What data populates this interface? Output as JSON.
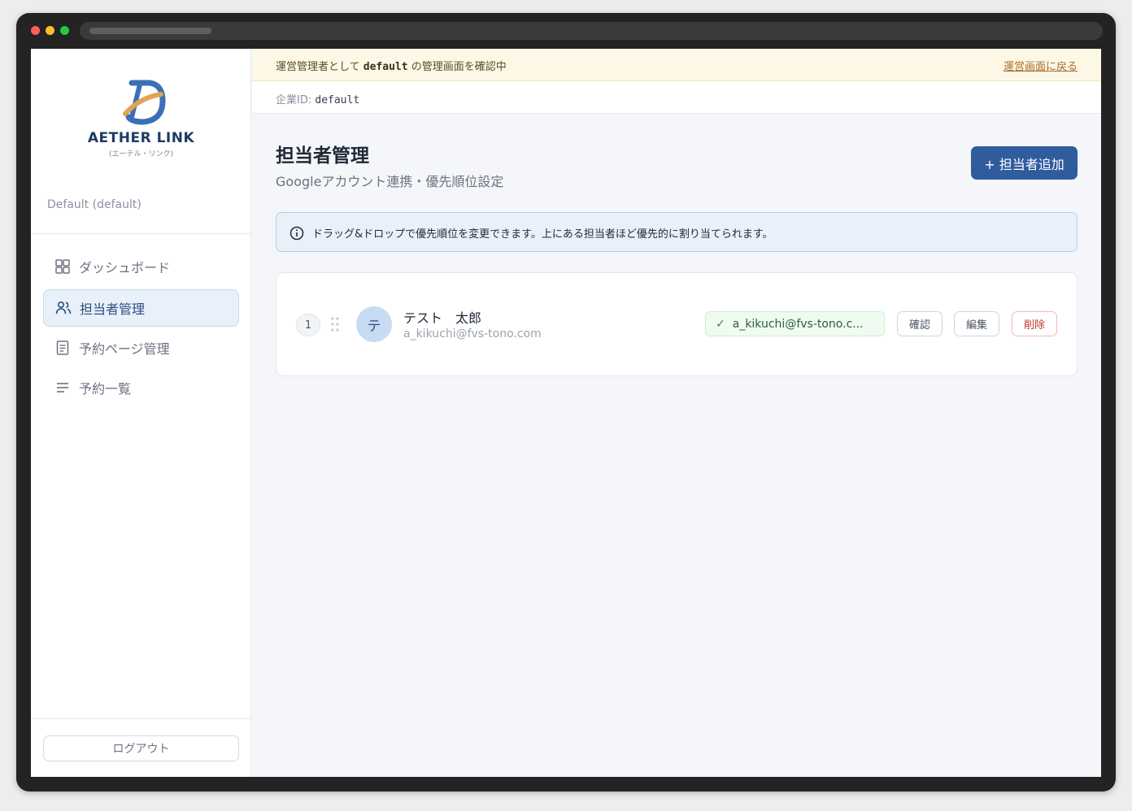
{
  "sidebar": {
    "brand": "AETHER LINK",
    "brand_sub": "(エーテル・リンク)",
    "tenant": "Default (default)",
    "items": [
      {
        "label": "ダッシュボード",
        "icon": "grid-icon"
      },
      {
        "label": "担当者管理",
        "icon": "users-icon",
        "active": true
      },
      {
        "label": "予約ページ管理",
        "icon": "document-icon"
      },
      {
        "label": "予約一覧",
        "icon": "list-icon"
      }
    ],
    "logout_label": "ログアウト"
  },
  "banner": {
    "prefix": "運営管理者として",
    "tenant_code": "default",
    "suffix": "の管理画面を確認中",
    "back_link": "運営画面に戻る"
  },
  "company": {
    "label": "企業ID:",
    "value": "default"
  },
  "page": {
    "title": "担当者管理",
    "subtitle": "Googleアカウント連携・優先順位設定",
    "add_button": "+ 担当者追加"
  },
  "info": {
    "text": "ドラッグ&ドロップで優先順位を変更できます。上にある担当者ほど優先的に割り当てられます。"
  },
  "staff": [
    {
      "rank": "1",
      "avatar": "テ",
      "name": "テスト　太郎",
      "email": "a_kikuchi@fvs-tono.com",
      "google_account": "a_kikuchi@fvs-tono.c...",
      "confirm_label": "確認",
      "edit_label": "編集",
      "delete_label": "削除"
    }
  ],
  "colors": {
    "primary": "#2f5c9c",
    "active_bg": "#e8f0fa",
    "banner_bg": "#fdf8e6",
    "success_bg": "#effaf1",
    "danger": "#c0392b"
  }
}
